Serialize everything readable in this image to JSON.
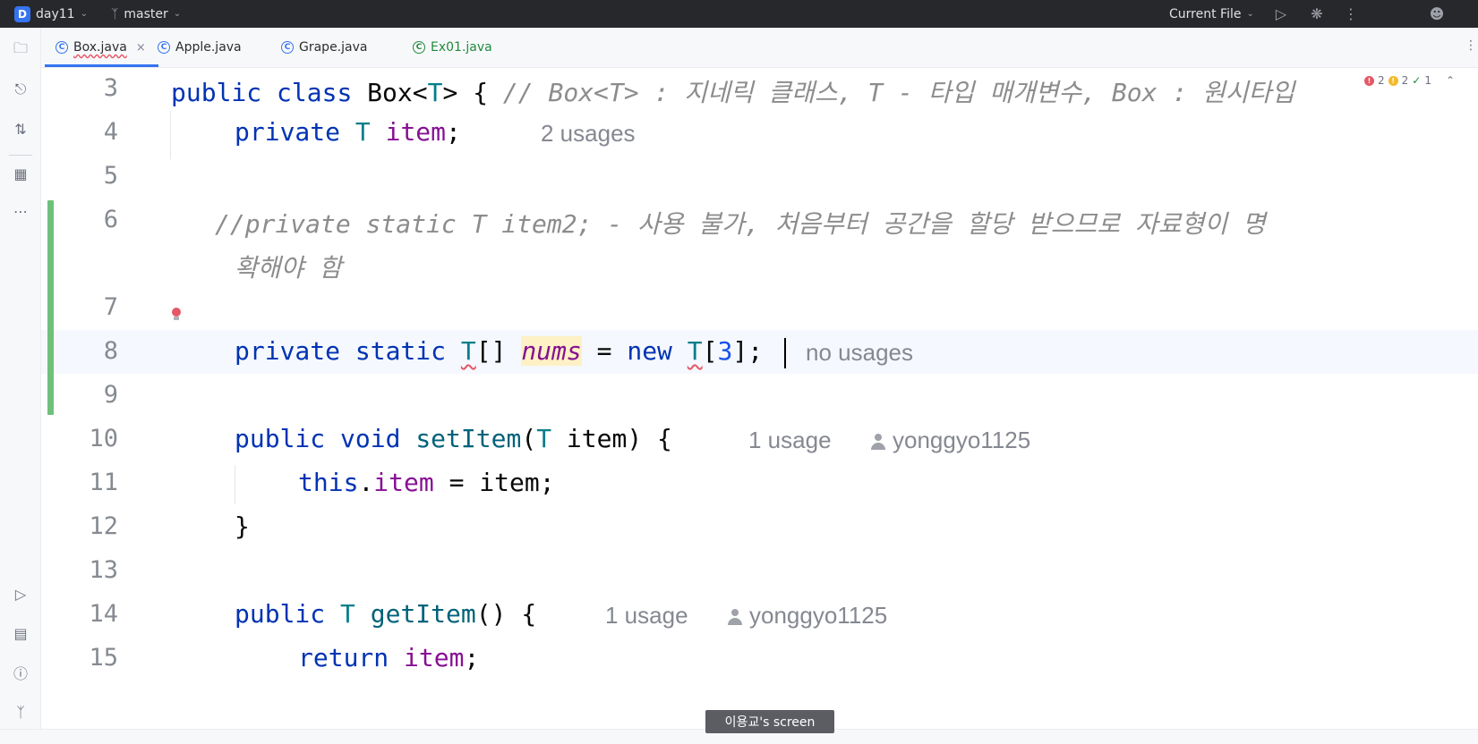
{
  "titlebar": {
    "project_badge": "D",
    "project_name": "day11",
    "branch_name": "master",
    "run_config": "Current File"
  },
  "tabs": [
    {
      "label": "Box.java",
      "active": true
    },
    {
      "label": "Apple.java",
      "active": false
    },
    {
      "label": "Grape.java",
      "active": false
    },
    {
      "label": "Ex01.java",
      "active": false
    }
  ],
  "inspections": {
    "errors": "2",
    "warnings": "2",
    "ok": "1"
  },
  "lines": [
    {
      "num": "3"
    },
    {
      "num": "4"
    },
    {
      "num": "5"
    },
    {
      "num": "6"
    },
    {
      "num": "7"
    },
    {
      "num": "8"
    },
    {
      "num": "9"
    },
    {
      "num": "10"
    },
    {
      "num": "11"
    },
    {
      "num": "12"
    },
    {
      "num": "13"
    },
    {
      "num": "14"
    },
    {
      "num": "15"
    }
  ],
  "code": {
    "l3": {
      "kw1": "public",
      "kw2": "class",
      "name": "Box",
      "lt": "<",
      "tp": "T",
      "gt": ">",
      "brace": "{",
      "comment": "// Box<T> : 지네릭 클래스, T - 타입 매개변수, Box : 원시타입"
    },
    "l4": {
      "kw": "private",
      "tp": "T",
      "field": "item",
      "semi": ";",
      "hint": "2 usages"
    },
    "l6": {
      "comment": "//private static T item2; - 사용 불가, 처음부터 공간을 할당 받으므로 자료형이 명",
      "comment_wrap": "확해야 함"
    },
    "l8": {
      "kw1": "private",
      "kw2": "static",
      "tp": "T",
      "brackets": "[]",
      "field": "nums",
      "eq": "=",
      "kw3": "new",
      "tp2": "T",
      "open": "[",
      "num": "3",
      "close": "];",
      "hint": "no usages"
    },
    "l10": {
      "kw1": "public",
      "kw2": "void",
      "fn": "setItem",
      "open": "(",
      "tp": "T",
      "param": "item",
      "close": ") {",
      "hint": "1 usage",
      "author": "yonggyo1125"
    },
    "l11": {
      "kw": "this",
      "dot": ".",
      "field": "item",
      "rest": "= item;"
    },
    "l12": {
      "brace": "}"
    },
    "l14": {
      "kw": "public",
      "tp": "T",
      "fn": "getItem",
      "rest": "() {",
      "hint": "1 usage",
      "author": "yonggyo1125"
    },
    "l15": {
      "kw": "return",
      "field": "item",
      "semi": ";"
    }
  },
  "screen_share_label": "이용교's screen",
  "icons": {
    "project": "folder-icon",
    "commit": "commit-icon",
    "pull_requests": "pull-request-icon",
    "structure": "structure-icon",
    "more": "more-icon",
    "run": "run-icon",
    "debug": "debug-icon",
    "add_user": "add-user-icon"
  }
}
